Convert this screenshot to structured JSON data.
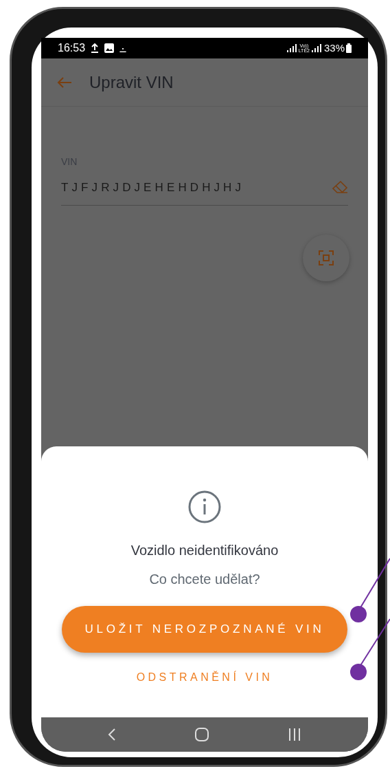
{
  "status_bar": {
    "time": "16:53",
    "network": [
      "Vo))",
      "LTE2"
    ],
    "battery": "33%"
  },
  "app_bar": {
    "title": "Upravit VIN"
  },
  "vin_field": {
    "label": "VIN",
    "value": "TJFJRJDJEHEHDHJHJ"
  },
  "dialog": {
    "title": "Vozidlo neidentifikováno",
    "message": "Co chcete udělat?",
    "buttons": [
      {
        "kind": "primary",
        "label": "ULOŽIT NEROZPOZNANÉ VIN"
      },
      {
        "kind": "text",
        "label": "ODSTRANĚNÍ VIN"
      }
    ]
  }
}
